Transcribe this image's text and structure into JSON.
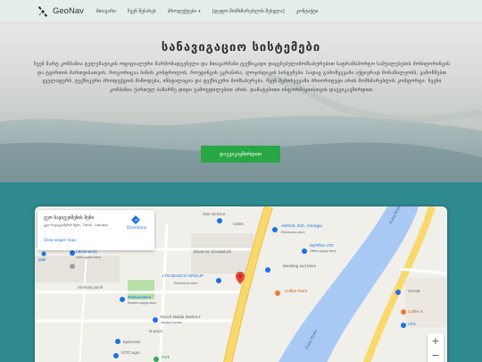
{
  "nav": {
    "brand": "GeoNav",
    "links": [
      "მთავარი",
      "ჩვენ შესახებ",
      "პროდუქტები",
      "[დეფო მომხმარებლის შესვლა]",
      "კონტაქტი"
    ]
  },
  "hero": {
    "title": "სანავიგაციო სისტემები",
    "description": "ჩვენ მარტ კომპანია ტელემატიკის ოფიციალური წარმომადგენელი და მთავარმანი ტექნიკადი დაყენებულიმომსახურებით სატრანსპორტო საშუალებების მონიტორინგის და ტვირთის მართვისათვის, როგორიცაა ბინის კონტროლის, როუტინგის ეკრანისა, ლოჯისტიკის სისტემები. სადაც გამოწვევაში აქტიურად მონაწილეობს, ვამოწმებთ ყველაფერს, ტექნიკური პროდუქციის მიწოდება, ინსტალაცია და ტექნიკური მომსახურება. ჩვენ შემთხვევაში პრიორიტეტი არის მომხმარებლის კომფორტი. ჩვენი კომპანია ქართულ ბაზარზე დიდი გამოცდილებით არის. დამატებითი ინფორმაციისთვის დაგვიკავშირდით.",
    "cta": "დაგვიკავშირდით"
  },
  "map": {
    "info": {
      "title": "გეო ნავიგეიშენის შენი",
      "address": "გეო ნავიგეიშენის შენი, Tbilisi, Georgia",
      "view_larger": "View larger map",
      "directions": "Directions"
    },
    "labels": {
      "one_service": "One Service",
      "cdek": "CDEK",
      "amsol": "AMSOL INC, Georgia",
      "amsol_sub": "Electronics store",
      "myoffice": "MyOffice LTD",
      "myoffice_sub": "Office supply store",
      "kura1": "Kura River",
      "kura2": "Kura River",
      "ekaterine": "Ekaterine Dzuliashvili",
      "lbgamer": "LBGamer34",
      "lbgamer_sub": "Video game store",
      "mall": "Mall",
      "arminas": "Arminas porch",
      "bosch": "LTD BOSCH GROUP",
      "bosch_sub": "Electronics store",
      "wedding": "Wedding and More",
      "coffee_point": "Coffee Point",
      "restaurateur": "Restaurateur",
      "restaurateur_sub": "Kitchen supply store",
      "bosch_makita": "Bosch Makita DeWALT",
      "bosch_makita_sub": "Service Center",
      "nwood": "N wood",
      "epilcenter": "Epilcenter",
      "igto": "IGTO agro",
      "park": "Park",
      "salve": "SALVE",
      "lpg": "LPG",
      "coffee_x": "Coffee X"
    }
  },
  "colors": {
    "accent_green": "#28a745",
    "teal_bg": "#2e8a8f",
    "river": "#a9c9f5",
    "road_yellow": "#f9d96d"
  }
}
